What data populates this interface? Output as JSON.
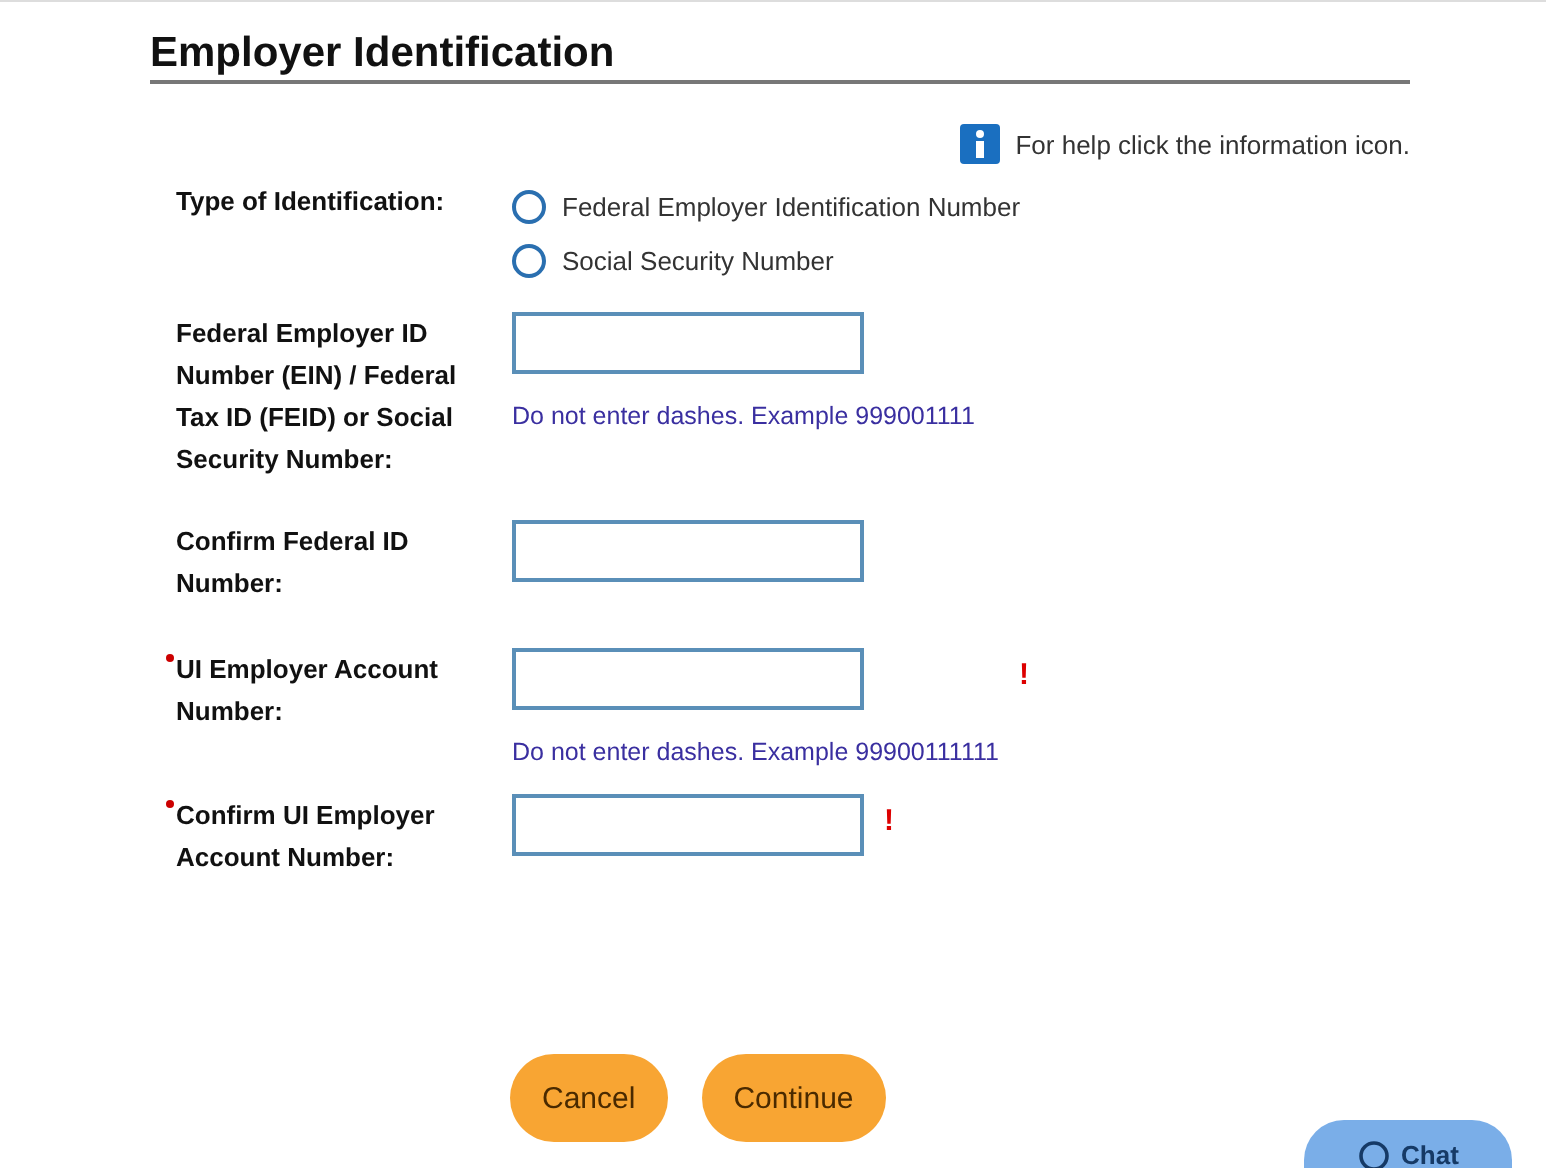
{
  "title": "Employer Identification",
  "help": {
    "text": "For help click the information icon."
  },
  "rows": [
    {
      "kind": "radio",
      "label": "Type of Identification:",
      "required": false,
      "options": [
        {
          "label": "Federal Employer Identification Number",
          "selected": false
        },
        {
          "label": "Social Security Number",
          "selected": false
        }
      ]
    },
    {
      "kind": "input",
      "label": "Federal Employer ID Number (EIN) / Federal Tax ID (FEID) or Social Security Number:",
      "required": false,
      "hint": "Do not enter dashes. Example 999001111"
    },
    {
      "kind": "input",
      "label": "Confirm Federal ID Number:",
      "required": false
    },
    {
      "kind": "input",
      "label": "UI Employer Account Number:",
      "required": true,
      "hint": "Do not enter dashes. Example 99900111111",
      "error": "!"
    },
    {
      "kind": "input",
      "label": "Confirm UI Employer Account Number:",
      "required": true,
      "error": "!"
    }
  ],
  "buttons": [
    "Cancel",
    "Continue"
  ],
  "chat": {
    "label": "Chat"
  }
}
